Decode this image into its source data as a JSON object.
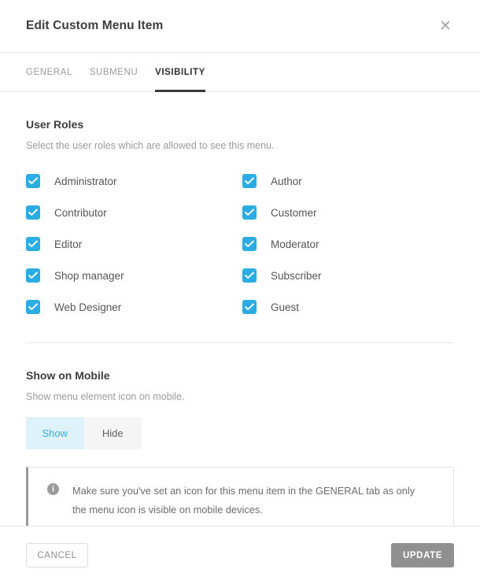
{
  "header": {
    "title": "Edit Custom Menu Item",
    "close_label": "✕"
  },
  "tabs": [
    {
      "label": "GENERAL",
      "active": false
    },
    {
      "label": "SUBMENU",
      "active": false
    },
    {
      "label": "VISIBILITY",
      "active": true
    }
  ],
  "user_roles": {
    "title": "User Roles",
    "description": "Select the user roles which are allowed to see this menu.",
    "items": [
      {
        "label": "Administrator",
        "checked": true
      },
      {
        "label": "Author",
        "checked": true
      },
      {
        "label": "Contributor",
        "checked": true
      },
      {
        "label": "Customer",
        "checked": true
      },
      {
        "label": "Editor",
        "checked": true
      },
      {
        "label": "Moderator",
        "checked": true
      },
      {
        "label": "Shop manager",
        "checked": true
      },
      {
        "label": "Subscriber",
        "checked": true
      },
      {
        "label": "Web Designer",
        "checked": true
      },
      {
        "label": "Guest",
        "checked": true
      }
    ]
  },
  "show_on_mobile": {
    "title": "Show on Mobile",
    "description": "Show menu element icon on mobile.",
    "options": [
      {
        "label": "Show",
        "selected": true
      },
      {
        "label": "Hide",
        "selected": false
      }
    ],
    "notice": {
      "icon": "info-icon",
      "text": "Make sure you've set an icon for this menu item in the GENERAL tab as only the menu icon is visible on mobile devices."
    }
  },
  "footer": {
    "cancel_label": "CANCEL",
    "update_label": "UPDATE"
  },
  "colors": {
    "accent": "#2bace3",
    "accent_soft": "#def2fc",
    "primary_button": "#909090",
    "border": "#e8e8e8",
    "text": "#555555",
    "muted": "#9b9b9b"
  }
}
